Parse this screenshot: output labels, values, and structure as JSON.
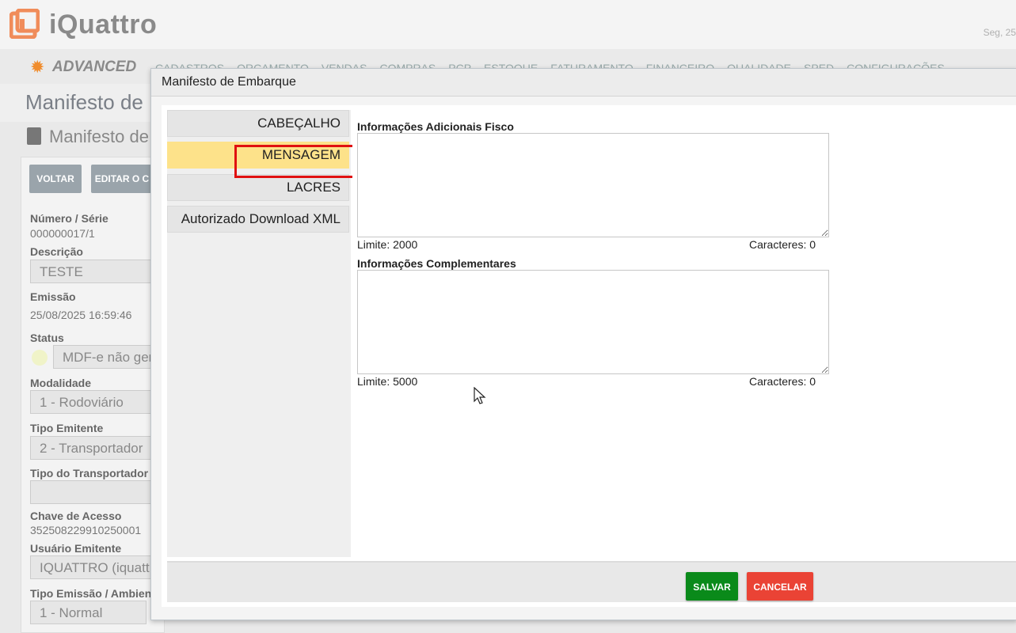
{
  "app": {
    "logo_text": "iQuattro",
    "date_text": "Seg, 25",
    "edition": "ADVANCED",
    "nav": [
      "CADASTROS",
      "ORÇAMENTO",
      "VENDAS",
      "COMPRAS",
      "PCP",
      "ESTOQUE",
      "FATURAMENTO",
      "FINANCEIRO",
      "QUALIDADE",
      "SPED",
      "CONFIGURAÇÕES"
    ],
    "page_title": "Manifesto de",
    "sub_title": "Manifesto de",
    "buttons": {
      "back": "VOLTAR",
      "edit": "EDITAR O C"
    },
    "fields": {
      "numero_label": "Número / Série",
      "numero_value": "000000017/1",
      "descricao_label": "Descrição",
      "descricao_value": "TESTE",
      "emissao_label": "Emissão",
      "emissao_value": "25/08/2025 16:59:46",
      "status_label": "Status",
      "status_value": "MDF-e não ger",
      "modalidade_label": "Modalidade",
      "modalidade_value": "1 - Rodoviário",
      "tipo_emitente_label": "Tipo Emitente",
      "tipo_emitente_value": "2 - Transportador",
      "tipo_transportador_label": "Tipo do Transportador",
      "chave_label": "Chave de Acesso",
      "chave_value": "352508229910250001",
      "usuario_label": "Usuário Emitente",
      "usuario_value": "IQUATTRO (iquatt",
      "tipo_emissao_label": "Tipo Emissão / Ambien",
      "tipo_emissao_value": "1 - Normal"
    }
  },
  "modal": {
    "title": "Manifesto de Embarque",
    "tabs": [
      {
        "label": "CABEÇALHO"
      },
      {
        "label": "MENSAGEM"
      },
      {
        "label": "LACRES"
      },
      {
        "label": "Autorizado Download XML"
      }
    ],
    "fisco": {
      "label": "Informações Adicionais Fisco",
      "limit": "Limite: 2000",
      "chars": "Caracteres: 0",
      "value": ""
    },
    "complementares": {
      "label": "Informações Complementares",
      "limit": "Limite: 5000",
      "chars": "Caracteres: 0",
      "value": ""
    },
    "save": "SALVAR",
    "cancel": "CANCELAR"
  },
  "colors": {
    "active_tab": "#fde28a",
    "highlight": "#e01010",
    "save": "#0a8a1a",
    "cancel": "#ea4335"
  }
}
